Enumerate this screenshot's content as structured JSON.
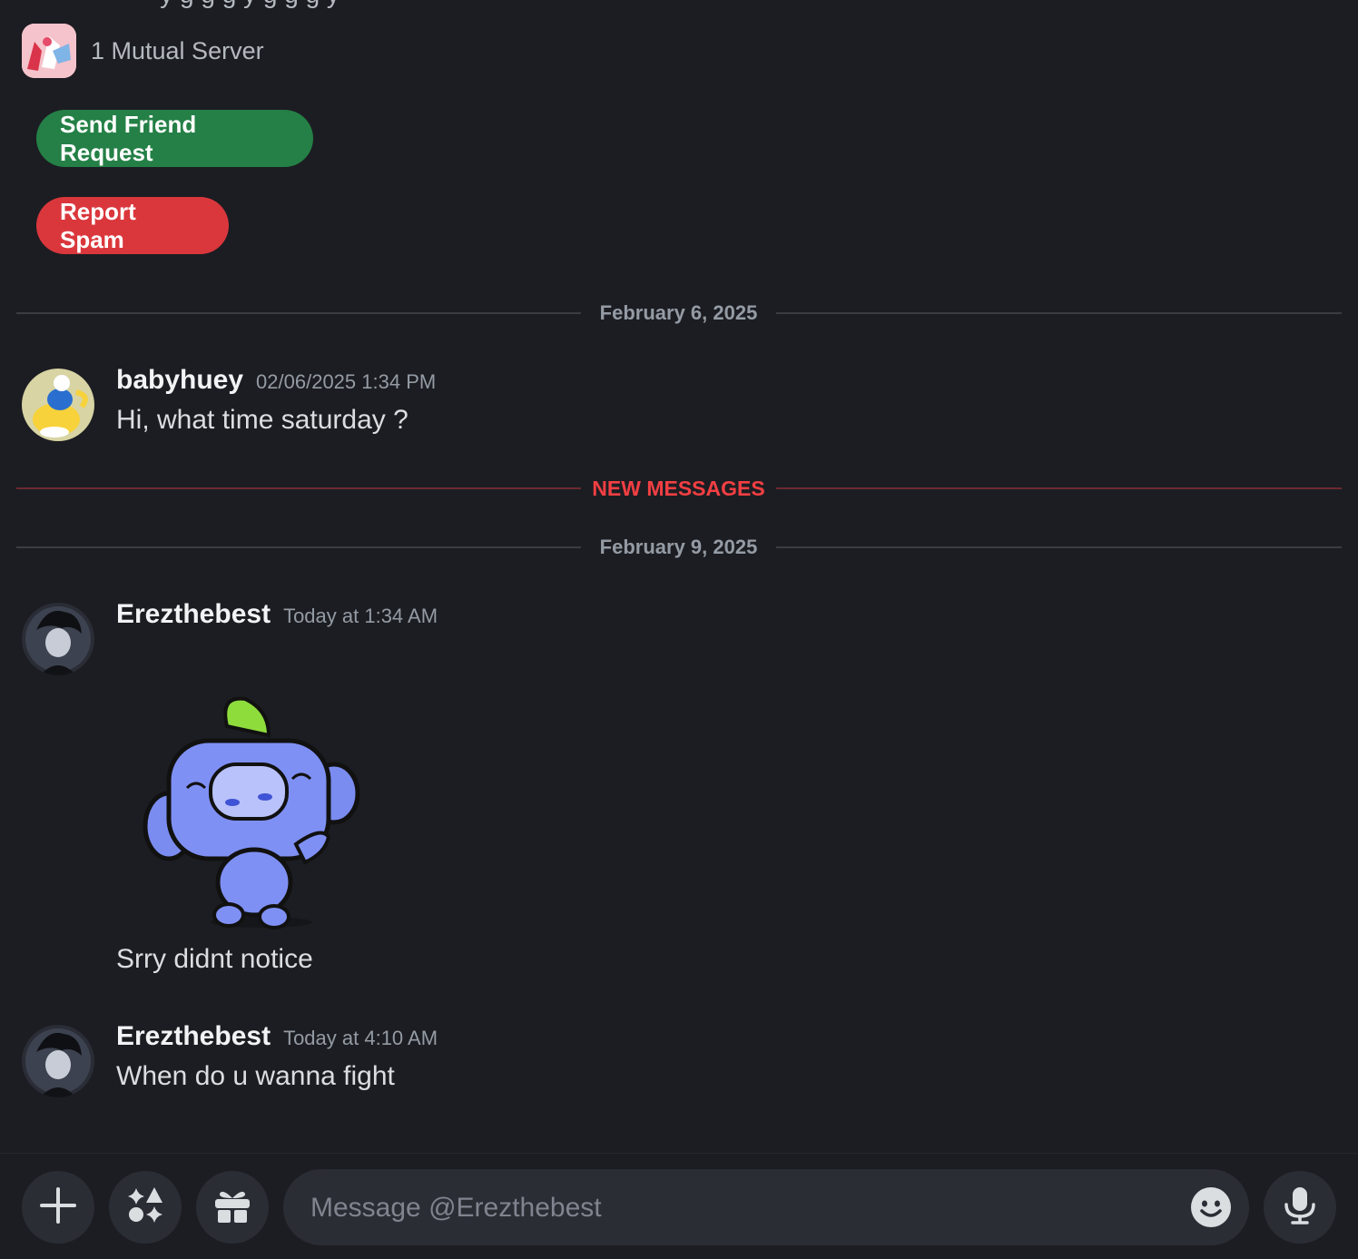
{
  "profile": {
    "bio_fragment": "~ ~ y g g g y g g g y",
    "mutual_servers_label": "1 Mutual Server",
    "send_friend_request_label": "Send Friend Request",
    "report_spam_label": "Report Spam"
  },
  "dividers": {
    "date1": "February 6, 2025",
    "new_messages": "NEW MESSAGES",
    "date2": "February 9, 2025"
  },
  "messages": [
    {
      "author": "babyhuey",
      "timestamp": "02/06/2025 1:34 PM",
      "text": "Hi, what time saturday ?"
    },
    {
      "author": "Erezthebest",
      "timestamp": "Today at 1:34 AM",
      "text": "Srry didnt notice"
    },
    {
      "author": "Erezthebest",
      "timestamp": "Today at 4:10 AM",
      "text": "When do u wanna fight"
    }
  ],
  "composer": {
    "placeholder": "Message @Erezthebest"
  },
  "icons": {
    "add": "plus-icon",
    "apps": "apps-icon",
    "gift": "gift-icon",
    "emoji": "emoji-icon",
    "mic": "microphone-icon"
  },
  "colors": {
    "friend_button": "#248046",
    "spam_button": "#da373c",
    "new_messages": "#f23f43"
  }
}
